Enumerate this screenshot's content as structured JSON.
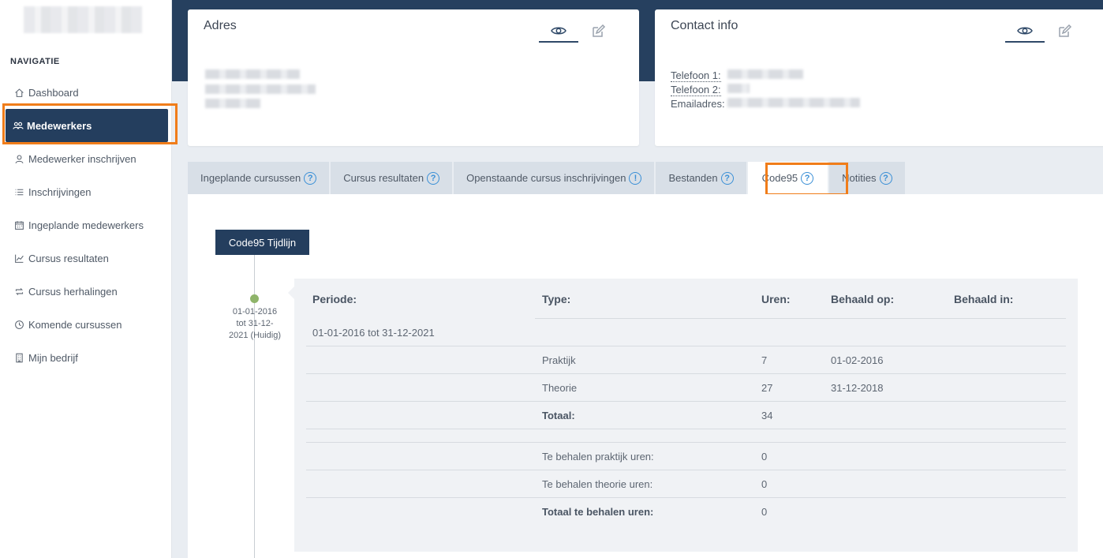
{
  "sidebar": {
    "heading": "NAVIGATIE",
    "items": [
      {
        "label": "Dashboard",
        "icon": "home-icon"
      },
      {
        "label": "Medewerkers",
        "icon": "users-icon",
        "active": true
      },
      {
        "label": "Medewerker inschrijven",
        "icon": "user-icon"
      },
      {
        "label": "Inschrijvingen",
        "icon": "list-icon"
      },
      {
        "label": "Ingeplande medewerkers",
        "icon": "calendar-icon"
      },
      {
        "label": "Cursus resultaten",
        "icon": "chart-icon"
      },
      {
        "label": "Cursus herhalingen",
        "icon": "repeat-icon"
      },
      {
        "label": "Komende cursussen",
        "icon": "clock-icon"
      },
      {
        "label": "Mijn bedrijf",
        "icon": "building-icon"
      }
    ]
  },
  "address_card": {
    "title": "Adres"
  },
  "contact_card": {
    "title": "Contact info",
    "phone1_label": "Telefoon 1:",
    "phone2_label": "Telefoon 2:",
    "email_label": "Emailadres:"
  },
  "tabs": [
    {
      "label": "Ingeplande cursussen",
      "badge": "?"
    },
    {
      "label": "Cursus resultaten",
      "badge": "?"
    },
    {
      "label": "Openstaande cursus inschrijvingen",
      "badge": "!"
    },
    {
      "label": "Bestanden",
      "badge": "?"
    },
    {
      "label": "Code95",
      "badge": "?",
      "active": true
    },
    {
      "label": "Notities",
      "badge": "?"
    }
  ],
  "timeline": {
    "button_label": "Code95 Tijdlijn",
    "entry_label": "01-01-2016 tot 31-12-2021 (Huidig)"
  },
  "detail": {
    "headers": {
      "periode": "Periode:",
      "type": "Type:",
      "uren": "Uren:",
      "behaald_op": "Behaald op:",
      "behaald_in": "Behaald in:"
    },
    "period_value": "01-01-2016 tot 31-12-2021",
    "rows": [
      {
        "type": "Praktijk",
        "uren": "7",
        "behaald_op": "01-02-2016"
      },
      {
        "type": "Theorie",
        "uren": "27",
        "behaald_op": "31-12-2018"
      }
    ],
    "totaal_label": "Totaal:",
    "totaal_value": "34",
    "remaining": [
      {
        "label": "Te behalen praktijk uren:",
        "value": "0"
      },
      {
        "label": "Te behalen theorie uren:",
        "value": "0"
      }
    ],
    "remaining_total_label": "Totaal te behalen uren:",
    "remaining_total_value": "0"
  },
  "colors": {
    "navy": "#243e5e",
    "highlight": "#f07d1a",
    "info_blue": "#3a8fd6",
    "timeline_dot": "#8fb46a"
  }
}
